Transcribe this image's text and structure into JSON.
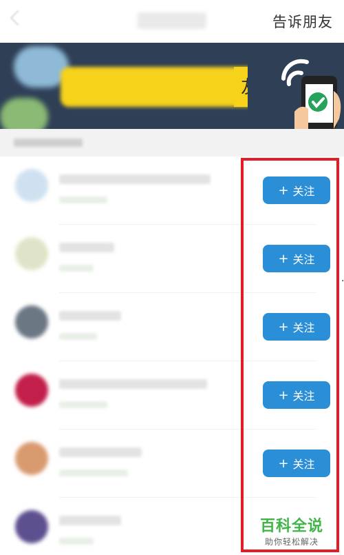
{
  "header": {
    "tell_friends": "告诉朋友"
  },
  "banner": {
    "text_fragment": "友"
  },
  "rows": [
    {
      "follow_label": "关注",
      "avatar_color": "#cfe1f0"
    },
    {
      "follow_label": "关注",
      "avatar_color": "#dfe4c8"
    },
    {
      "follow_label": "关注",
      "avatar_color": "#6c7784"
    },
    {
      "follow_label": "关注",
      "avatar_color": "#c21f4a"
    },
    {
      "follow_label": "关注",
      "avatar_color": "#d99a70"
    },
    {
      "avatar_color": "#5e4f8f"
    }
  ],
  "watermark": {
    "title": "百科全说",
    "subtitle": "助你轻松解决"
  },
  "colors": {
    "accent": "#2b8fd8",
    "highlight": "#e31c25",
    "banner_bg": "#2e3f56"
  }
}
